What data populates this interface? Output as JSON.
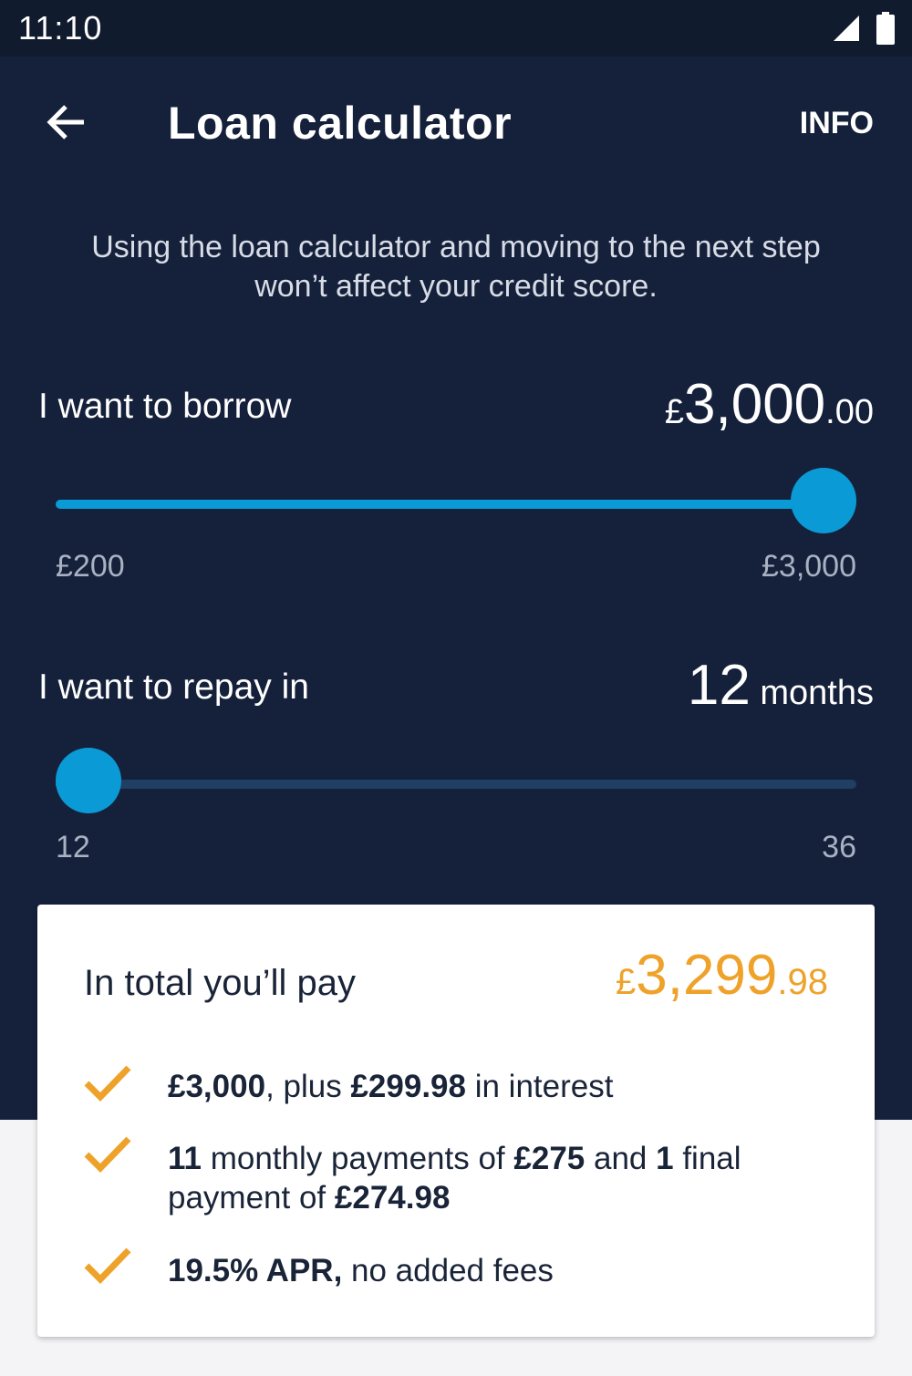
{
  "status_bar": {
    "time": "11:10"
  },
  "app_bar": {
    "title": "Loan calculator",
    "info_label": "INFO"
  },
  "intro": {
    "text": "Using the loan calculator and moving to the next step won’t affect your credit score."
  },
  "borrow": {
    "label": "I want to borrow",
    "currency": "£",
    "amount_main": "3,000",
    "amount_decimal": ".00",
    "min_label": "£200",
    "max_label": "£3,000",
    "slider_fraction": 1.0
  },
  "repay": {
    "label": "I want to repay in",
    "value": "12",
    "unit": " months",
    "min_label": "12",
    "max_label": "36",
    "slider_fraction": 0.0
  },
  "summary": {
    "total_label": "In total you’ll pay",
    "total_currency": "£",
    "total_main": "3,299",
    "total_decimal": ".98",
    "line1": {
      "b1": "£3,000",
      "t1": ", plus ",
      "b2": "£299.98",
      "t2": " in interest"
    },
    "line2": {
      "b1": "11",
      "t1": " monthly payments of ",
      "b2": "£275",
      "t2": " and ",
      "b3": "1",
      "t3": " final payment of ",
      "b4": "£274.98"
    },
    "line3": {
      "b1": "19.5% APR,",
      "t1": " no added fees"
    }
  },
  "colors": {
    "background_dark": "#15213b",
    "accent_blue": "#0a9ad6",
    "accent_orange": "#eea22a"
  },
  "icons": [
    "back-arrow-icon",
    "signal-icon",
    "battery-icon",
    "checkmark-icon"
  ]
}
